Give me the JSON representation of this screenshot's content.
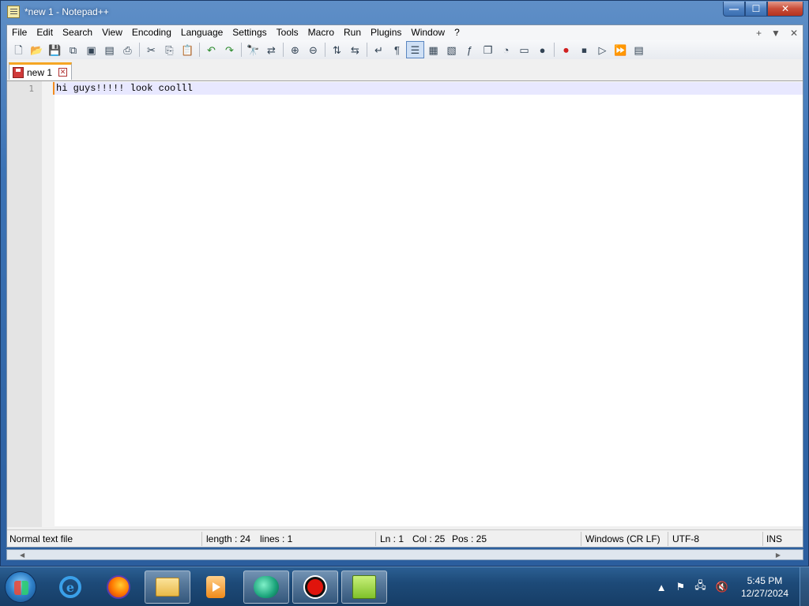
{
  "window": {
    "title": "*new 1 - Notepad++",
    "min_label": "—",
    "max_label": "☐",
    "close_label": "✕"
  },
  "menu": {
    "items": [
      "File",
      "Edit",
      "Search",
      "View",
      "Encoding",
      "Language",
      "Settings",
      "Tools",
      "Macro",
      "Run",
      "Plugins",
      "Window",
      "?"
    ],
    "right": {
      "add": "+",
      "dropdown": "▼",
      "close": "✕"
    }
  },
  "toolbar": {
    "icons": [
      "new-file-icon",
      "open-file-icon",
      "save-icon",
      "save-all-icon",
      "close-icon",
      "close-all-icon",
      "print-icon",
      "cut-icon",
      "copy-icon",
      "paste-icon",
      "undo-icon",
      "redo-icon",
      "find-icon",
      "replace-icon",
      "zoom-in-icon",
      "zoom-out-icon",
      "sync-vertical-icon",
      "sync-horizontal-icon",
      "word-wrap-icon",
      "show-all-chars-icon",
      "indent-guide-icon",
      "udl-icon",
      "doc-map-icon",
      "function-list-icon",
      "doc-list-icon",
      "monitor-icon",
      "folder-workspace-icon",
      "chat-icon",
      "record-macro-icon",
      "stop-record-icon",
      "play-macro-icon",
      "run-macro-multiple-icon",
      "save-macro-icon"
    ],
    "active_icon": "indent-guide-icon"
  },
  "tab": {
    "label": "new 1",
    "close": "✕"
  },
  "editor": {
    "line_number": "1",
    "content": "hi guys!!!!! look coolll"
  },
  "status": {
    "file_type": "Normal text file",
    "length": "length : 24",
    "lines": "lines : 1",
    "ln": "Ln : 1",
    "col": "Col : 25",
    "pos": "Pos : 25",
    "eol": "Windows (CR LF)",
    "encoding": "UTF-8",
    "mode": "INS"
  },
  "scroll": {
    "left": "◀",
    "right": "▶"
  },
  "taskbar": {
    "apps": [
      "internet-explorer-icon",
      "firefox-icon",
      "file-explorer-icon",
      "media-player-icon",
      "bird-app-icon",
      "record-app-icon",
      "notepadpp-icon"
    ],
    "tray_arrow": "▲",
    "time": "5:45 PM",
    "date": "12/27/2024"
  }
}
